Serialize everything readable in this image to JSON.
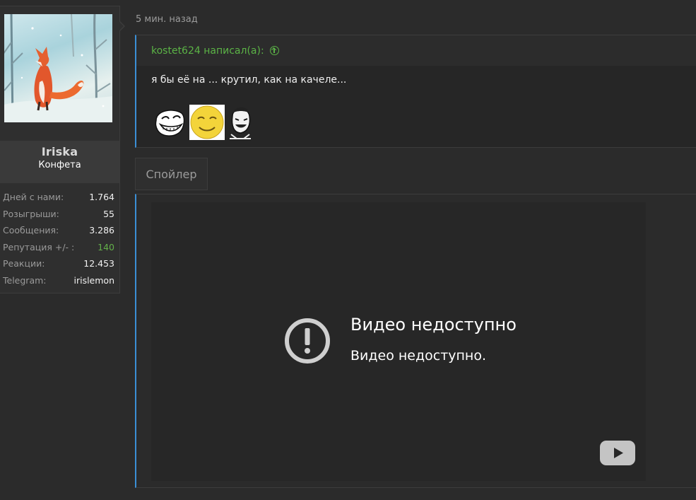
{
  "user": {
    "name": "Iriska",
    "title": "Конфета",
    "stats": [
      {
        "label": "Дней с нами:",
        "value": "1.764"
      },
      {
        "label": "Розыгрыши:",
        "value": "55"
      },
      {
        "label": "Сообщения:",
        "value": "3.286"
      },
      {
        "label": "Репутация +/- :",
        "value": "140",
        "color": "#63b04a"
      },
      {
        "label": "Реакции:",
        "value": "12.453"
      },
      {
        "label": "Telegram:",
        "value": "irislemon"
      }
    ]
  },
  "post": {
    "timestamp": "5 мин. назад",
    "quote": {
      "author_line": "kostet624 написал(а):",
      "text": "я бы её на ... крутил, как на качеле...",
      "smilies": [
        "trollface-smilie",
        "yellow-smug-smilie",
        "laughing-man-smilie"
      ]
    },
    "spoiler": {
      "label": "Спойлер",
      "video": {
        "title": "Видео недоступно",
        "subtitle": "Видео недоступно."
      }
    }
  },
  "colors": {
    "accent_blue": "#3b8fd6",
    "green": "#5bb346",
    "background": "#2b2b2b"
  }
}
